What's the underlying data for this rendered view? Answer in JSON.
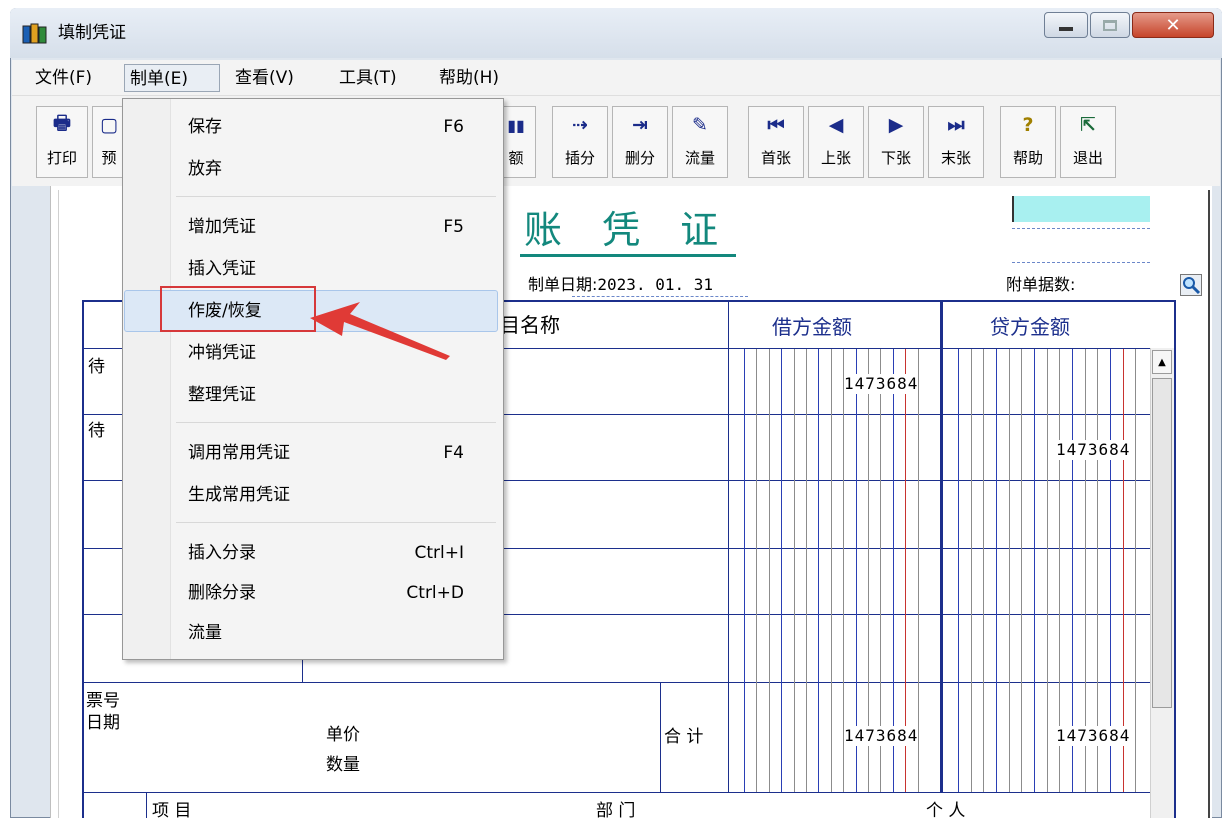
{
  "window": {
    "title": "填制凭证"
  },
  "menubar": {
    "items": [
      "文件(F)",
      "制单(E)",
      "查看(V)",
      "工具(T)",
      "帮助(H)"
    ]
  },
  "toolbar": {
    "left": [
      {
        "icon": "printer-icon",
        "label": "打印"
      },
      {
        "icon": "preview-icon",
        "label": "预"
      },
      {
        "icon": "amount-icon",
        "label": "额"
      }
    ],
    "right": [
      {
        "icon": "insert-entry-icon",
        "label": "插分"
      },
      {
        "icon": "delete-entry-icon",
        "label": "删分"
      },
      {
        "icon": "cash-flow-icon",
        "label": "流量"
      },
      {
        "icon": "first-icon",
        "label": "首张"
      },
      {
        "icon": "previous-icon",
        "label": "上张"
      },
      {
        "icon": "next-icon",
        "label": "下张"
      },
      {
        "icon": "last-icon",
        "label": "末张"
      },
      {
        "icon": "help-icon",
        "label": "帮助"
      },
      {
        "icon": "exit-icon",
        "label": "退出"
      }
    ]
  },
  "voucher": {
    "title_visible": "账 凭 证",
    "date_label": "制单日期:",
    "date_value": "2023. 01. 31",
    "attachments_label": "附单据数:",
    "col_subject_partial": "目名称",
    "col_debit": "借方金额",
    "col_credit": "贷方金额",
    "rows": [
      {
        "summary": "待",
        "debit": "1473684",
        "credit": ""
      },
      {
        "summary": "待",
        "debit": "",
        "credit": "1473684"
      }
    ],
    "footer": {
      "ticket_no": "票号",
      "date": "日期",
      "unit_price": "单价",
      "quantity": "数量",
      "total_label": "合 计",
      "total_debit": "1473684",
      "total_credit": "1473684",
      "item_label": "项 目",
      "department_label": "部 门",
      "person_label": "个 人"
    }
  },
  "dropdown": {
    "items": [
      {
        "label": "保存",
        "shortcut": "F6"
      },
      {
        "label": "放弃",
        "shortcut": ""
      },
      {
        "label": "增加凭证",
        "shortcut": "F5"
      },
      {
        "label": "插入凭证",
        "shortcut": ""
      },
      {
        "label": "作废/恢复",
        "shortcut": ""
      },
      {
        "label": "冲销凭证",
        "shortcut": ""
      },
      {
        "label": "整理凭证",
        "shortcut": ""
      },
      {
        "label": "调用常用凭证",
        "shortcut": "F4"
      },
      {
        "label": "生成常用凭证",
        "shortcut": ""
      },
      {
        "label": "插入分录",
        "shortcut": "Ctrl+I"
      },
      {
        "label": "删除分录",
        "shortcut": "Ctrl+D"
      },
      {
        "label": "流量",
        "shortcut": ""
      }
    ]
  },
  "colors": {
    "title_teal": "#13887d",
    "grid_blue": "#1c2f8c",
    "highlight_red": "#d6383a",
    "cyan_field": "#a8f0f0"
  }
}
